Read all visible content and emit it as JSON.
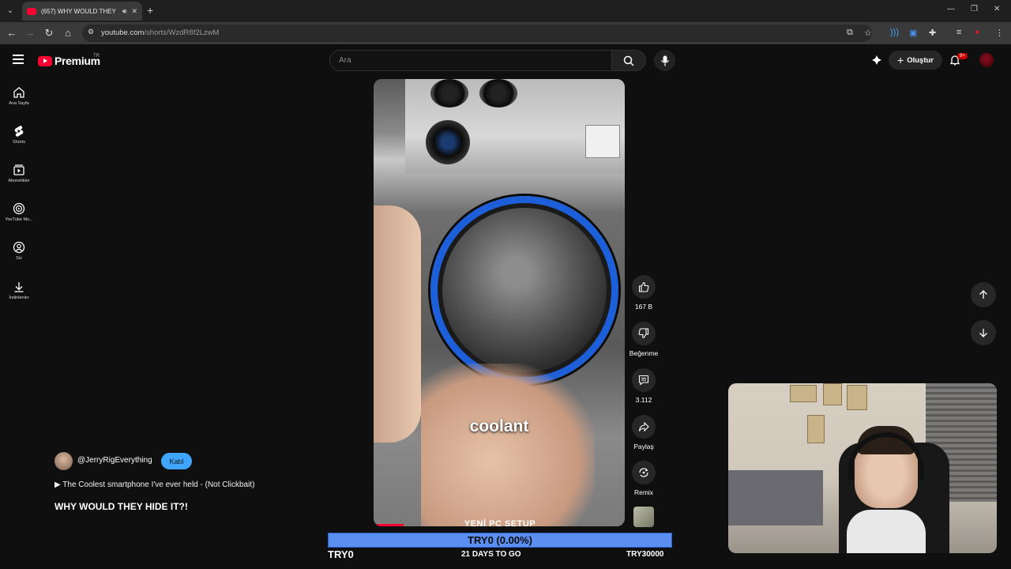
{
  "browser": {
    "tab_title": "(657) WHY WOULD THEY H",
    "new_tab": "+",
    "url_domain": "youtube.com",
    "url_path": "/shorts/WzdR8f2LzwM"
  },
  "header": {
    "logo_text": "Premium",
    "country": "TR",
    "search_placeholder": "Ara",
    "create_label": "Oluştur",
    "notif_count": "9+"
  },
  "sidebar": {
    "items": [
      {
        "label": "Ana Sayfa",
        "icon": "home-icon"
      },
      {
        "label": "Shorts",
        "icon": "shorts-icon"
      },
      {
        "label": "Abonelikler",
        "icon": "subscriptions-icon"
      },
      {
        "label": "YouTube Mu...",
        "icon": "youtube-music-icon"
      },
      {
        "label": "Siz",
        "icon": "you-icon"
      },
      {
        "label": "İndirilenler",
        "icon": "downloads-icon"
      }
    ]
  },
  "video": {
    "caption": "coolant",
    "progress": 0.12
  },
  "actions": {
    "like_count": "167 B",
    "dislike_label": "Beğenme",
    "comment_count": "3.112",
    "share_label": "Paylaş",
    "remix_label": "Remix"
  },
  "info": {
    "channel": "@JerryRigEverything",
    "join_label": "Katıl",
    "related": "▶ The Coolest smartphone I've ever held - (Not Clickbait)",
    "title": "WHY WOULD THEY HIDE IT?!"
  },
  "goal": {
    "title": "YENİ PC SETUP",
    "progress_text": "TRY0 (0.00%)",
    "current": "TRY0",
    "days_left": "21 DAYS TO GO",
    "target": "TRY30000",
    "progress": 0.0
  }
}
